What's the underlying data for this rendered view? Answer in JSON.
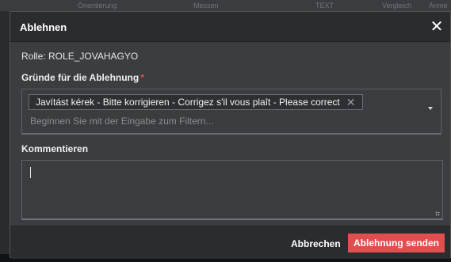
{
  "background": {
    "header_columns": [
      "Orientierung",
      "Messen",
      "TEXT",
      "Vergleich",
      "Anme"
    ]
  },
  "modal": {
    "title": "Ablehnen",
    "close_symbol": "✕",
    "role_line": "Rolle: ROLE_JOVAHAGYO",
    "reasons": {
      "label": "Gründe für die Ablehnung",
      "required_marker": "*",
      "selected_chip": "Javítást kérek - Bitte korrigieren - Corrigez s'il vous plaît - Please correct",
      "chip_remove_symbol": "✕",
      "filter_placeholder": "Beginnen Sie mit der Eingabe zum Filtern..."
    },
    "comment": {
      "label": "Kommentieren",
      "value": ""
    },
    "footer": {
      "cancel_label": "Abbrechen",
      "submit_label": "Ablehnung senden"
    }
  },
  "colors": {
    "accent_red": "#e04e4e",
    "required_red": "#e84c4c",
    "modal_bg": "#3b3d40",
    "header_bg": "#2b2c2f"
  },
  "icons": {
    "close": "close-icon",
    "chip_remove": "close-icon",
    "dropdown": "chevron-down-icon",
    "resize": "resize-grip-icon"
  }
}
